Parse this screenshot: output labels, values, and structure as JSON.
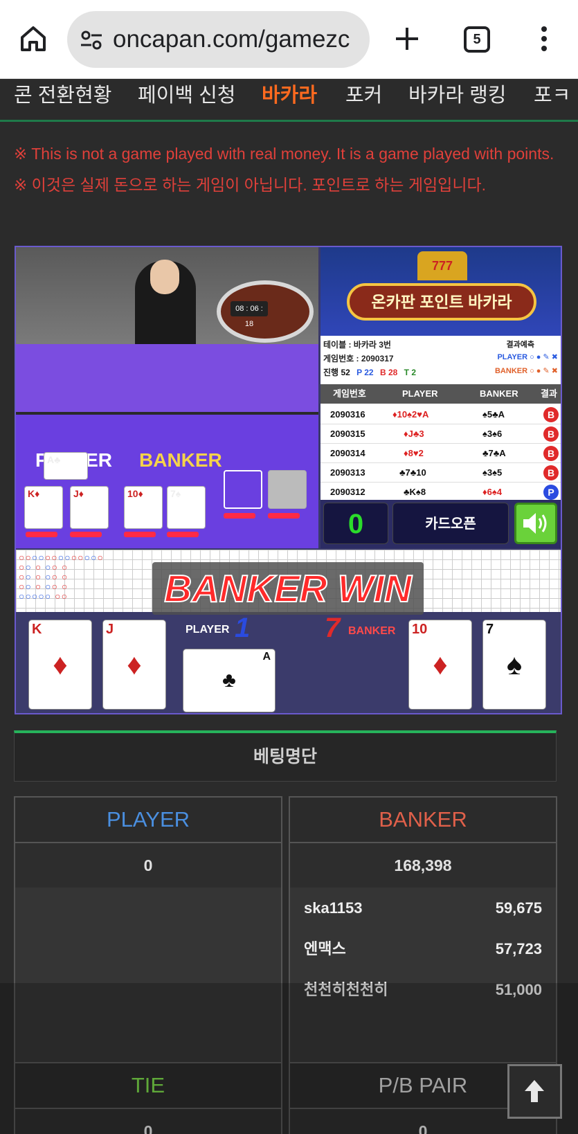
{
  "browser": {
    "url": "oncapan.com/gamezc",
    "tab_count": "5"
  },
  "nav": {
    "items": [
      "콘 전환현황",
      "페이백 신청",
      "바카라",
      "포커",
      "바카라 랭킹",
      "포ㅋ"
    ],
    "active_index": 2
  },
  "notice": {
    "line_en": "※ This is not a game played with real money. It is a game played with points.",
    "line_ko": "※ 이것은 실제 돈으로 하는 게임이 아닙니다. 포인트로 하는 게임입니다."
  },
  "game": {
    "video": {
      "timer": "08 : 06 : 18",
      "player_label": "PLAYER",
      "banker_label": "BANKER"
    },
    "banner": {
      "slot": "777",
      "title": "온카판 포인트 바카라"
    },
    "info": {
      "table": "테이블 : 바카라 3번",
      "game_no": "게임번호 : 2090317",
      "progress_label": "진행",
      "progress": "52",
      "p_count": "P 22",
      "b_count": "B 28",
      "t_count": "T 2",
      "prediction_label": "결과예측",
      "pred_player": "PLAYER",
      "pred_banker": "BANKER"
    },
    "history": {
      "headers": [
        "게임번호",
        "PLAYER",
        "BANKER",
        "결과"
      ],
      "rows": [
        {
          "no": "2090316",
          "player": "♦10♠2♥A",
          "banker": "♠5♣A",
          "result": "B"
        },
        {
          "no": "2090315",
          "player": "♦J♣3",
          "banker": "♠3♠6",
          "result": "B"
        },
        {
          "no": "2090314",
          "player": "♦8♥2",
          "banker": "♣7♣A",
          "result": "B"
        },
        {
          "no": "2090313",
          "player": "♣7♣10",
          "banker": "♠3♠5",
          "result": "B"
        },
        {
          "no": "2090312",
          "player": "♣K♠8",
          "banker": "♦6♠4",
          "result": "P"
        }
      ]
    },
    "controls": {
      "count": "0",
      "card_open": "카드오픈"
    },
    "result": {
      "banner": "BANKER WIN",
      "player_label": "PLAYER",
      "player_score": "1",
      "banker_label": "BANKER",
      "banker_score": "7",
      "player_cards": [
        {
          "rank": "K",
          "suit": "♦"
        },
        {
          "rank": "J",
          "suit": "♦"
        },
        {
          "rank": "A",
          "suit": "♣"
        }
      ],
      "banker_cards": [
        {
          "rank": "10",
          "suit": "♦"
        },
        {
          "rank": "7",
          "suit": "♠"
        }
      ]
    }
  },
  "betting": {
    "title": "베팅명단",
    "player": {
      "label": "PLAYER",
      "total": "0",
      "color": "#4a8fe0"
    },
    "banker": {
      "label": "BANKER",
      "total": "168,398",
      "color": "#e0604a",
      "entries": [
        {
          "name": "ska1153",
          "amount": "59,675"
        },
        {
          "name": "엔맥스",
          "amount": "57,723"
        },
        {
          "name": "천천히천천히",
          "amount": "51,000"
        }
      ]
    },
    "tie": {
      "label": "TIE",
      "total": "0",
      "color": "#7ad84a"
    },
    "pair": {
      "label": "P/B PAIR",
      "total": "0"
    }
  },
  "colors": {
    "accent_orange": "#ff6a1f",
    "notice_red": "#e0403a",
    "green_line": "#26b35b"
  }
}
